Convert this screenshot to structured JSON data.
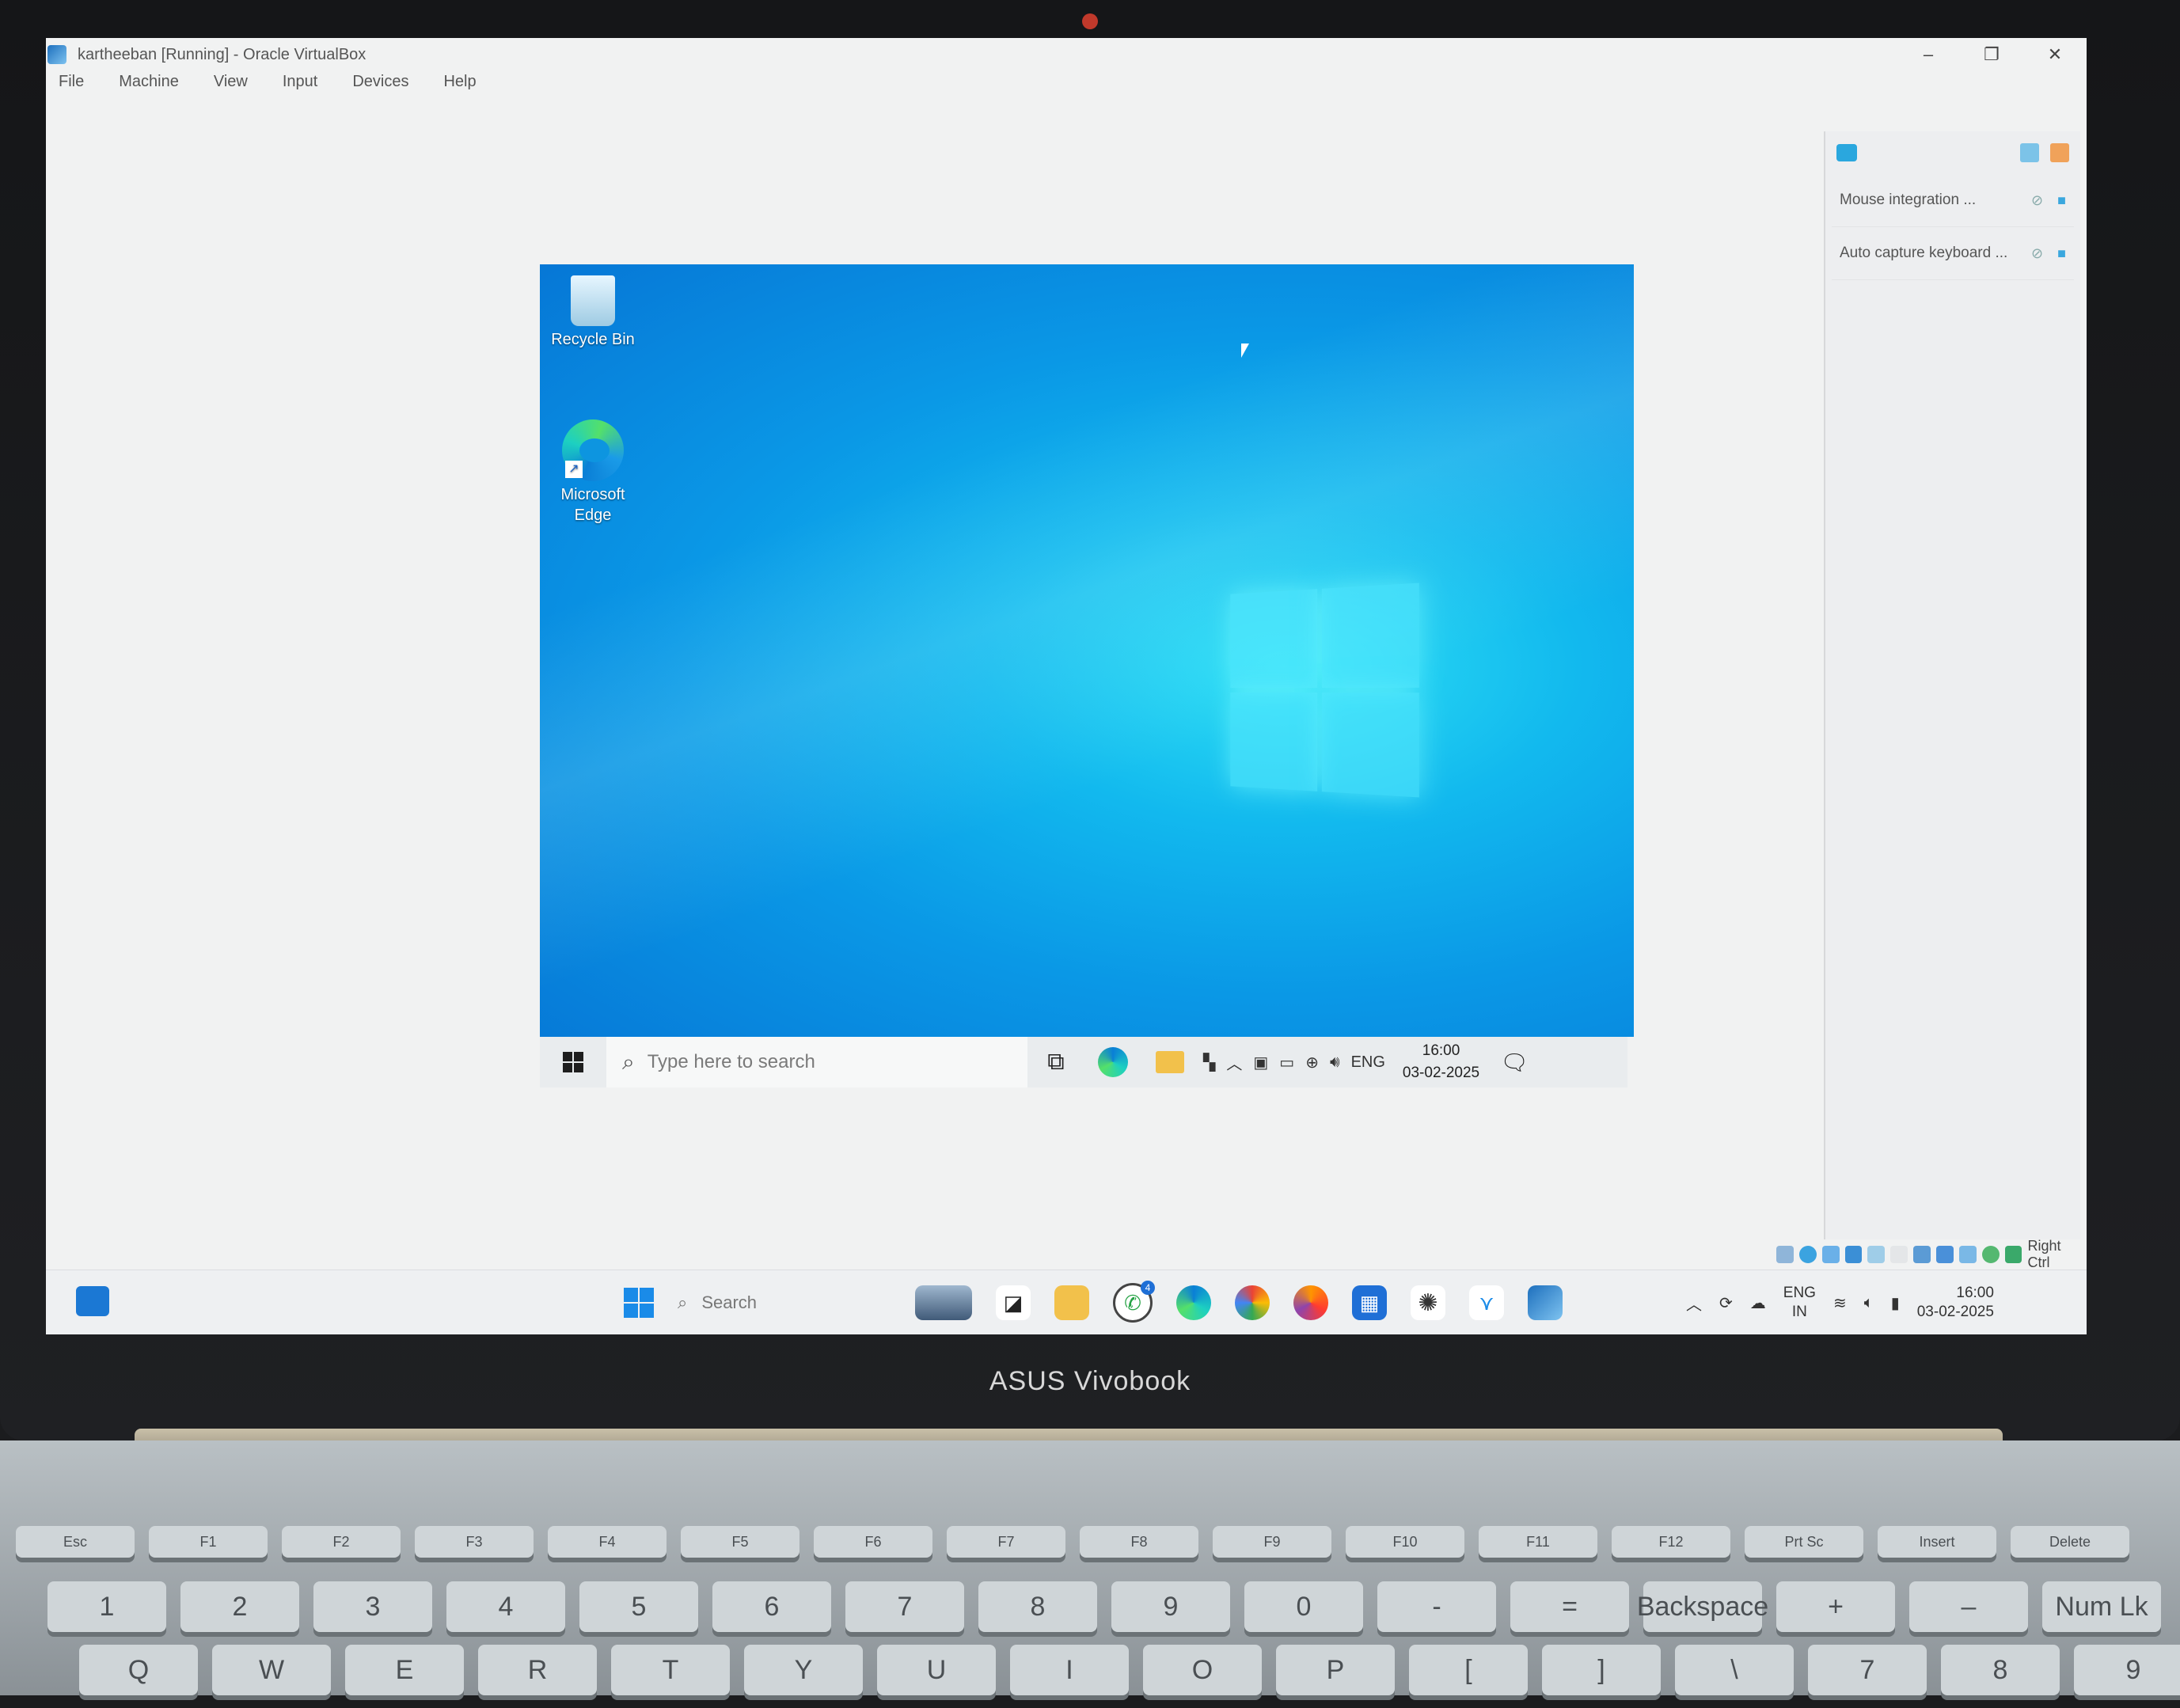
{
  "window": {
    "title": "kartheeban [Running] - Oracle VirtualBox",
    "menu": [
      "File",
      "Machine",
      "View",
      "Input",
      "Devices",
      "Help"
    ],
    "controls": {
      "minimize": "–",
      "maximize": "❐",
      "close": "✕"
    }
  },
  "guest": {
    "desktop_icons": [
      {
        "label": "Recycle Bin",
        "icon": "recycle-bin-icon"
      },
      {
        "label": "Microsoft Edge",
        "icon": "edge-icon"
      }
    ],
    "taskbar": {
      "search_placeholder": "Type here to search",
      "tray_language": "ENG",
      "time": "16:00",
      "date": "03-02-2025"
    }
  },
  "vbox_panel": {
    "rows": [
      {
        "label": "Mouse integration ..."
      },
      {
        "label": "Auto capture keyboard ..."
      }
    ],
    "host_key": "Right Ctrl"
  },
  "host": {
    "taskbar": {
      "search_placeholder": "Search",
      "whatsapp_badge": "4",
      "language": "ENG",
      "region": "IN",
      "time": "16:00",
      "date": "03-02-2025"
    }
  },
  "device": {
    "brand": "ASUS Vivobook",
    "keys_row1": [
      "Esc",
      "F1",
      "F2",
      "F3",
      "F4",
      "F5",
      "F6",
      "F7",
      "F8",
      "F9",
      "F10",
      "F11",
      "F12",
      "Prt Sc",
      "Insert",
      "Delete"
    ],
    "keys_row2": [
      "1",
      "2",
      "3",
      "4",
      "5",
      "6",
      "7",
      "8",
      "9",
      "0",
      "-",
      "=",
      "Backspace",
      "+",
      "–",
      "Num Lk"
    ],
    "keys_row3": [
      "Q",
      "W",
      "E",
      "R",
      "T",
      "Y",
      "U",
      "I",
      "O",
      "P",
      "[",
      "]",
      "\\",
      "7",
      "8",
      "9"
    ]
  },
  "colors": {
    "desktop_blue": "#0a98e6",
    "accent": "#1a8be8"
  }
}
